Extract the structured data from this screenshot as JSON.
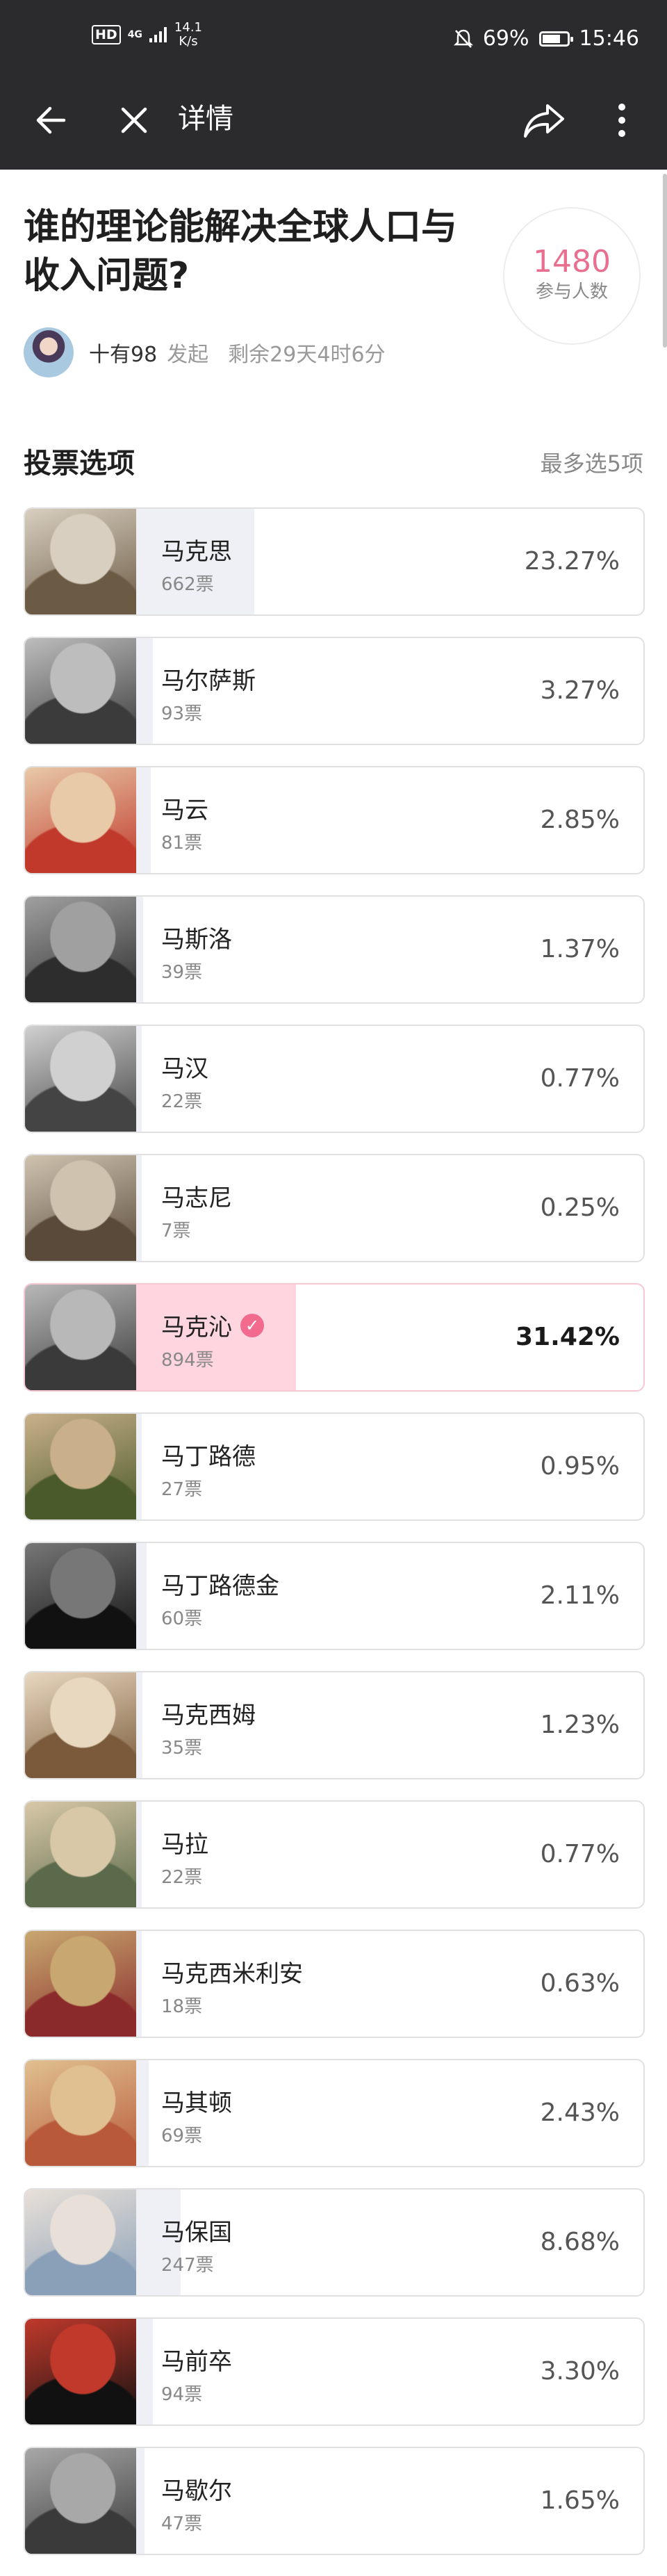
{
  "status_bar": {
    "hd": "HD",
    "signal": "4G",
    "speed_top": "14.1",
    "speed_bottom": "K/s",
    "battery": "69%",
    "time": "15:46"
  },
  "nav": {
    "title": "详情",
    "back_icon": "back-arrow-icon",
    "close_icon": "close-icon",
    "share_icon": "share-icon",
    "more_icon": "more-vertical-icon"
  },
  "poll": {
    "title": "谁的理论能解决全球人口与收入问题?",
    "participants": "1480",
    "participants_label": "参与人数",
    "author": "十有98",
    "launched": "发起",
    "remaining": "剩余29天4时6分"
  },
  "section": {
    "title": "投票选项",
    "max": "最多选5项"
  },
  "options": [
    {
      "name": "马克思",
      "votes": "662票",
      "percent": "23.27%",
      "fraction": 0.2327,
      "selected": false,
      "colors": [
        "#6b5a44",
        "#d8cfc0"
      ]
    },
    {
      "name": "马尔萨斯",
      "votes": "93票",
      "percent": "3.27%",
      "fraction": 0.0327,
      "selected": false,
      "colors": [
        "#3b3b3b",
        "#bdbdbd"
      ]
    },
    {
      "name": "马云",
      "votes": "81票",
      "percent": "2.85%",
      "fraction": 0.0285,
      "selected": false,
      "colors": [
        "#c0392b",
        "#e8c9a8"
      ]
    },
    {
      "name": "马斯洛",
      "votes": "39票",
      "percent": "1.37%",
      "fraction": 0.0137,
      "selected": false,
      "colors": [
        "#2d2d2d",
        "#a0a0a0"
      ]
    },
    {
      "name": "马汉",
      "votes": "22票",
      "percent": "0.77%",
      "fraction": 0.0077,
      "selected": false,
      "colors": [
        "#444444",
        "#d0d0d0"
      ]
    },
    {
      "name": "马志尼",
      "votes": "7票",
      "percent": "0.25%",
      "fraction": 0.0025,
      "selected": false,
      "colors": [
        "#5a4a3a",
        "#cfc3b0"
      ]
    },
    {
      "name": "马克沁",
      "votes": "894票",
      "percent": "31.42%",
      "fraction": 0.3142,
      "selected": true,
      "colors": [
        "#3a3a3a",
        "#b8b8b8"
      ]
    },
    {
      "name": "马丁路德",
      "votes": "27票",
      "percent": "0.95%",
      "fraction": 0.0095,
      "selected": false,
      "colors": [
        "#4a5a2a",
        "#c9b08a"
      ]
    },
    {
      "name": "马丁路德金",
      "votes": "60票",
      "percent": "2.11%",
      "fraction": 0.0211,
      "selected": false,
      "colors": [
        "#111111",
        "#777777"
      ]
    },
    {
      "name": "马克西姆",
      "votes": "35票",
      "percent": "1.23%",
      "fraction": 0.0123,
      "selected": false,
      "colors": [
        "#7a5a3a",
        "#e8d8c0"
      ]
    },
    {
      "name": "马拉",
      "votes": "22票",
      "percent": "0.77%",
      "fraction": 0.0077,
      "selected": false,
      "colors": [
        "#5a6a4a",
        "#d8c8a8"
      ]
    },
    {
      "name": "马克西米利安",
      "votes": "18票",
      "percent": "0.63%",
      "fraction": 0.0063,
      "selected": false,
      "colors": [
        "#8a2a2a",
        "#c8a870"
      ]
    },
    {
      "name": "马其顿",
      "votes": "69票",
      "percent": "2.43%",
      "fraction": 0.0243,
      "selected": false,
      "colors": [
        "#b85a3a",
        "#e0c090"
      ]
    },
    {
      "name": "马保国",
      "votes": "247票",
      "percent": "8.68%",
      "fraction": 0.0868,
      "selected": false,
      "colors": [
        "#8aa0b8",
        "#e8e0d8"
      ]
    },
    {
      "name": "马前卒",
      "votes": "94票",
      "percent": "3.30%",
      "fraction": 0.033,
      "selected": false,
      "colors": [
        "#111111",
        "#c0392b"
      ]
    },
    {
      "name": "马歇尔",
      "votes": "47票",
      "percent": "1.65%",
      "fraction": 0.0165,
      "selected": false,
      "colors": [
        "#3a3a3a",
        "#a8a8a8"
      ]
    }
  ]
}
